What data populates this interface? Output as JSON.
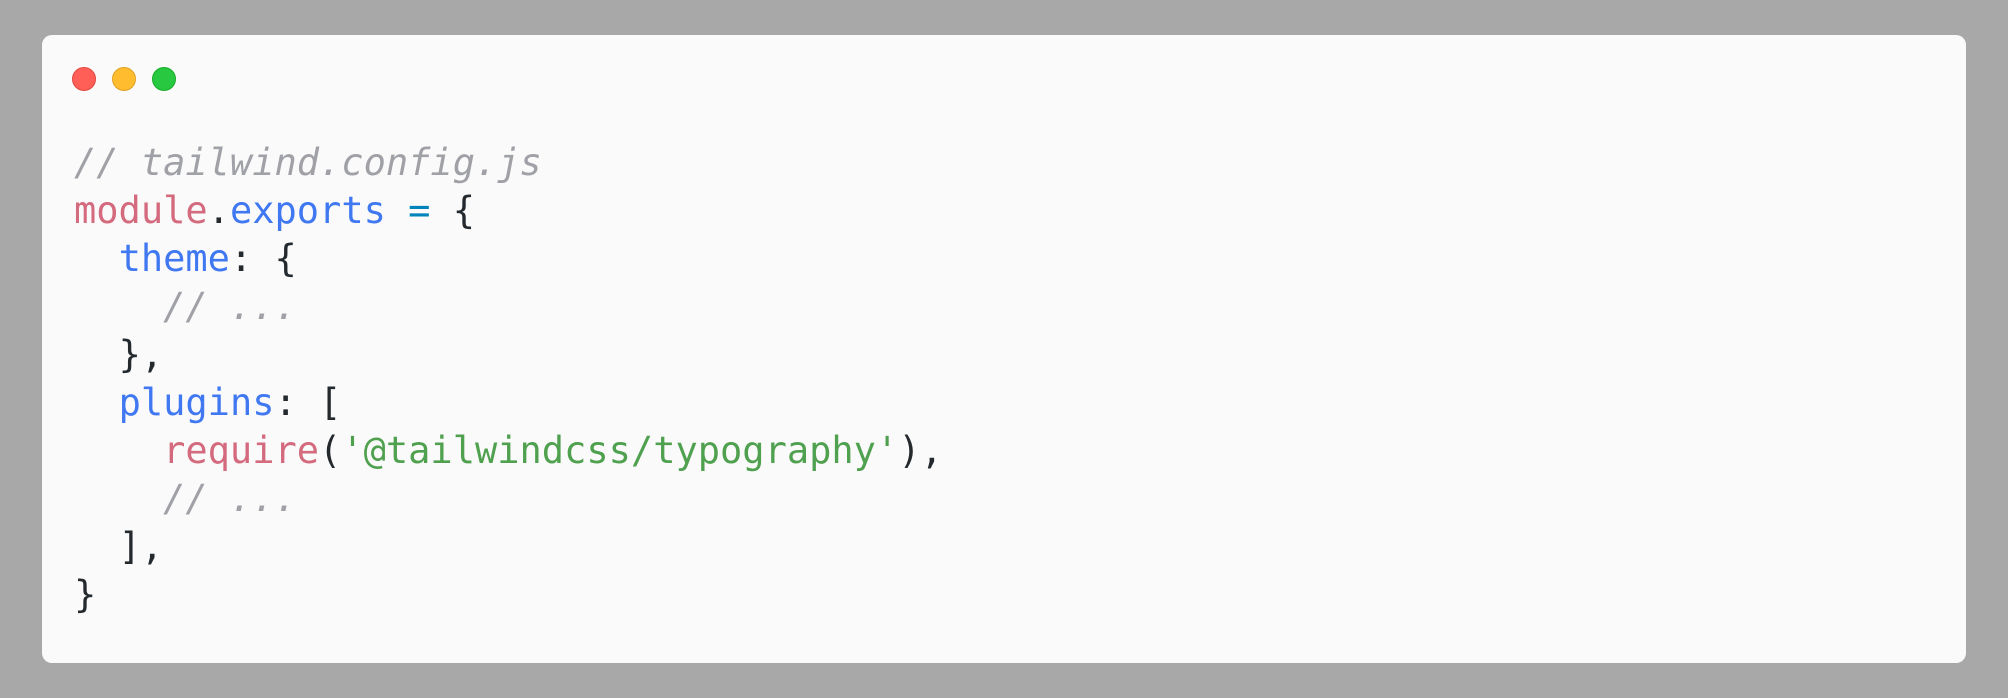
{
  "window": {
    "controls": {
      "close": "close",
      "minimize": "minimize",
      "zoom": "zoom"
    }
  },
  "code": {
    "lines": [
      {
        "comment": "// tailwind.config.js"
      },
      {
        "module": "module",
        "dot": ".",
        "exports": "exports",
        "assign": " = ",
        "brace": "{"
      },
      {
        "indent": "  ",
        "key": "theme",
        "colon": ": ",
        "brace": "{"
      },
      {
        "indent": "    ",
        "comment": "// ..."
      },
      {
        "indent": "  ",
        "close": "},"
      },
      {
        "indent": "  ",
        "key": "plugins",
        "colon": ": ",
        "bracket": "["
      },
      {
        "indent": "    ",
        "fn": "require",
        "open": "(",
        "str": "'@tailwindcss/typography'",
        "close": "),"
      },
      {
        "indent": "    ",
        "comment": "// ..."
      },
      {
        "indent": "  ",
        "close": "],"
      },
      {
        "close": "}"
      }
    ]
  },
  "colors": {
    "background": "#a8a8a8",
    "window": "#fafafa",
    "comment": "#a0a1a7",
    "keyword": "#d46a7e",
    "property": "#4078f2",
    "string": "#50a14f"
  }
}
